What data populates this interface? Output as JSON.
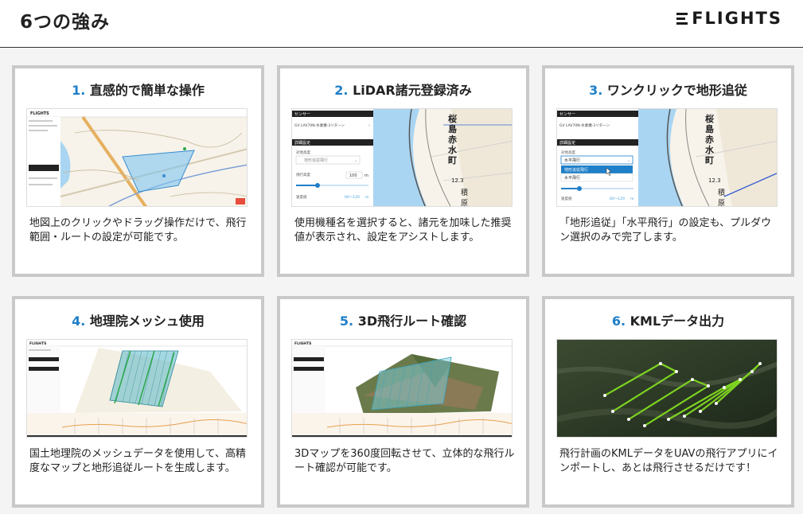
{
  "header": {
    "title": "6つの強み",
    "logo_text": "FLIGHTS",
    "logo_icon": "menu-lines-logo-icon"
  },
  "cards": [
    {
      "num": "1.",
      "title": "直感的で簡単な操作",
      "desc": "地図上のクリックやドラッグ操作だけで、飛行範囲・ルートの設定が可能です。"
    },
    {
      "num": "2.",
      "title": "LiDAR諸元登録済み",
      "desc": "使用機種名を選択すると、諸元を加味した推奨値が表示され、設定をアシストします。"
    },
    {
      "num": "3.",
      "title": "ワンクリックで地形追従",
      "desc": "「地形追従」「水平飛行」の設定も、プルダウン選択のみで完了します。"
    },
    {
      "num": "4.",
      "title": "地理院メッシュ使用",
      "desc": "国土地理院のメッシュデータを使用して、高精度なマップと地形追従ルートを生成します。"
    },
    {
      "num": "5.",
      "title": "3D飛行ルート確認",
      "desc": "3Dマップを360度回転させて、立体的な飛行ルート確認が可能です。"
    },
    {
      "num": "6.",
      "title": "KMLデータ出力",
      "desc": "飛行計画のKMLデータをUAVの飛行アプリにインポートし、あとは飛行させるだけです！"
    }
  ],
  "thumb_ui": {
    "app_name": "FLIGHTS",
    "sensor_label": "センサー",
    "sensor_value": "GV LAV70N-水素機-3リターン",
    "detail_label": "詳細設定",
    "terrain_label": "対地高度",
    "terrain_value": "地形追従飛行",
    "altitude_label": "飛行高度",
    "altitude_value": "100",
    "altitude_unit": "m",
    "speed_label": "速度値",
    "speed_value": "60～120",
    "speed_unit": "m",
    "option_terrain": "地形追従飛行",
    "option_level": "水平飛行",
    "selected_level": "水平飛行",
    "map_label_1": "桜",
    "map_label_2": "島",
    "map_label_3": "赤",
    "map_label_4": "水",
    "map_label_5": "町",
    "map_label_6": "12.3",
    "map_label_7": "積",
    "map_label_8": "原"
  },
  "colors": {
    "accent": "#1f7fc8",
    "card_border": "#c9c9c9",
    "route_green": "#7ed321",
    "area_fill": "#7fc4ee"
  }
}
